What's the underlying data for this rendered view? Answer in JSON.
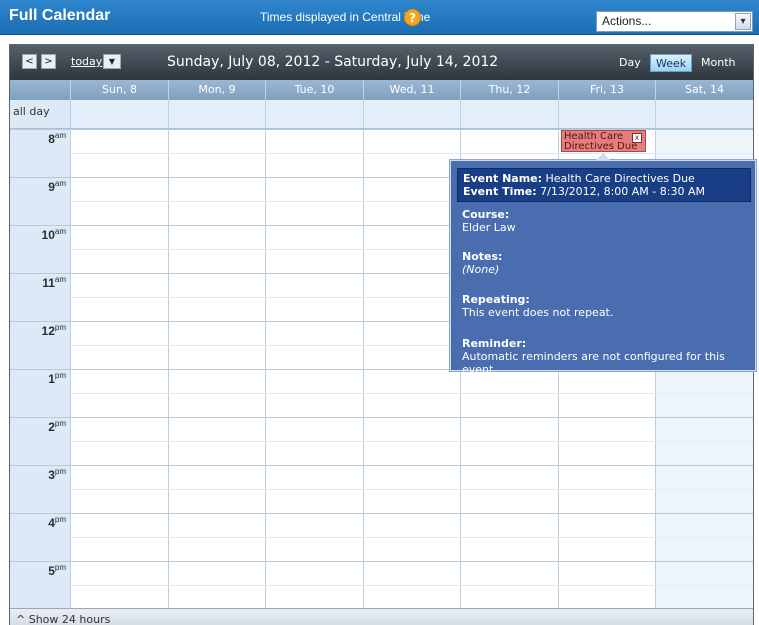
{
  "header": {
    "title": "Full Calendar",
    "timezone_note": "Times displayed in Central Time",
    "help_glyph": "?",
    "actions_label": "Actions...",
    "actions_arrow": "▾"
  },
  "toolbar": {
    "prev_glyph": "<",
    "next_glyph": ">",
    "today_label": "today",
    "dropdown_glyph": "▼",
    "date_range": "Sunday, July 08, 2012 - Saturday, July 14, 2012",
    "views": [
      {
        "label": "Day",
        "active": false
      },
      {
        "label": "Week",
        "active": true
      },
      {
        "label": "Month",
        "active": false
      }
    ]
  },
  "days": [
    "Sun, 8",
    "Mon, 9",
    "Tue, 10",
    "Wed, 11",
    "Thu, 12",
    "Fri, 13",
    "Sat, 14"
  ],
  "allday_label": "all day",
  "hours": [
    {
      "h": "8",
      "ap": "am"
    },
    {
      "h": "9",
      "ap": "am"
    },
    {
      "h": "10",
      "ap": "am"
    },
    {
      "h": "11",
      "ap": "am"
    },
    {
      "h": "12",
      "ap": "pm"
    },
    {
      "h": "1",
      "ap": "pm"
    },
    {
      "h": "2",
      "ap": "pm"
    },
    {
      "h": "3",
      "ap": "pm"
    },
    {
      "h": "4",
      "ap": "pm"
    },
    {
      "h": "5",
      "ap": "pm"
    }
  ],
  "event": {
    "label": "Health Care Directives Due",
    "close_glyph": "x"
  },
  "popup": {
    "event_name_label": "Event Name:",
    "event_name": "Health Care Directives Due",
    "event_time_label": "Event Time:",
    "event_time": "7/13/2012, 8:00 AM - 8:30 AM",
    "course_label": "Course:",
    "course": "Elder Law",
    "notes_label": "Notes:",
    "notes": "(None)",
    "repeating_label": "Repeating:",
    "repeating": "This event does not repeat.",
    "reminder_label": "Reminder:",
    "reminder": "Automatic reminders are not configured for this event."
  },
  "footer": {
    "glyph": "^",
    "label": "Show 24 hours"
  },
  "colors": {
    "header_blue": "#1c6db3",
    "event_red": "#e47d7d",
    "popup_blue": "#4a6db0"
  }
}
